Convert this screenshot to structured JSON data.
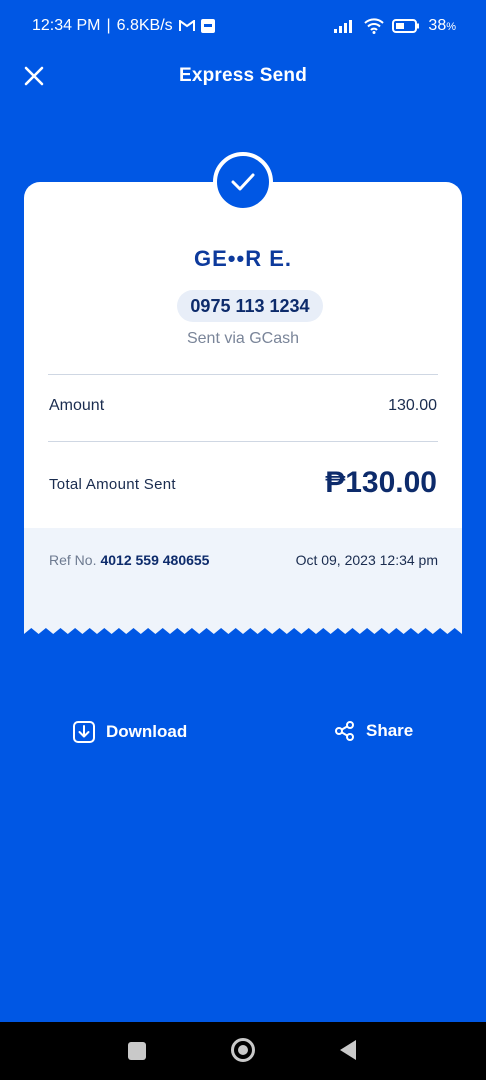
{
  "status_bar": {
    "time": "12:34 PM",
    "net_speed": "6.8KB/s",
    "battery": "38"
  },
  "header": {
    "title": "Express Send"
  },
  "receipt": {
    "recipient_name": "GE••R E.",
    "phone": "0975 113 1234",
    "sent_via": "Sent via GCash",
    "amount_label": "Amount",
    "amount_value": "130.00",
    "total_label": "Total Amount Sent",
    "total_value": "₱130.00",
    "ref_label": "Ref No.",
    "ref_number": "4012 559 480655",
    "date": "Oct 09, 2023 12:34 pm"
  },
  "actions": {
    "download_label": "Download",
    "share_label": "Share"
  },
  "colors": {
    "background": "#0057e4",
    "card": "#ffffff",
    "card_footer": "#eff4fb",
    "text_dark": "#0d2b6b"
  }
}
